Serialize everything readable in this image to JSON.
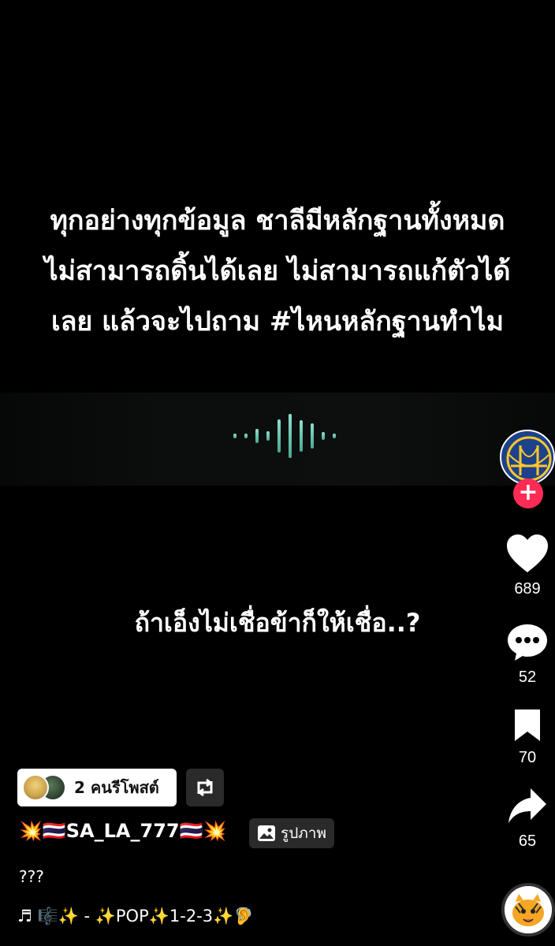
{
  "captions": {
    "top": "ทุกอย่างทุกข้อมูล ชาลีมีหลักฐานทั้งหมด\nไม่สามารถดิ้นได้เลย ไม่สามารถแก้ตัวได้\nเลย แล้วจะไปถาม #ไหนหลักฐานทำไม",
    "middle": "ถ้าเอ็งไม่เชื่อข้าก็ให้เชื่อ..?"
  },
  "actions": {
    "likes": "689",
    "comments": "52",
    "saves": "70",
    "shares": "65"
  },
  "repost": {
    "label": "2 คนรีโพสต์"
  },
  "post": {
    "author_prefix": "💥🇹🇭",
    "author": "SA_LA_777",
    "author_suffix": "🇹🇭💥",
    "media_badge": "รูปภาพ",
    "description": "???",
    "music": "♬ 🎼✨ - ✨POP✨1-2-3✨🦻"
  },
  "colors": {
    "follow": "#fe2c55",
    "avatar_bg": "#1d428a",
    "wave": "#7fd8c2"
  },
  "icons": [
    "golden-state-logo-icon",
    "plus-icon",
    "heart-icon",
    "comment-icon",
    "bookmark-icon",
    "share-icon",
    "repost-icon",
    "image-icon",
    "music-note-icon",
    "music-disc-icon"
  ]
}
